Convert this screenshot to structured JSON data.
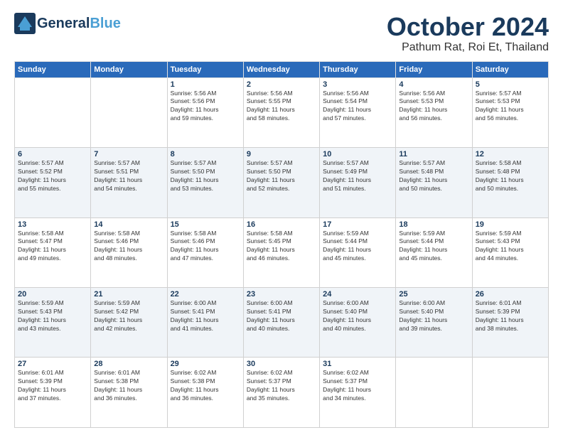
{
  "header": {
    "logo_main": "General",
    "logo_accent": "Blue",
    "month_title": "October 2024",
    "location": "Pathum Rat, Roi Et, Thailand"
  },
  "days_of_week": [
    "Sunday",
    "Monday",
    "Tuesday",
    "Wednesday",
    "Thursday",
    "Friday",
    "Saturday"
  ],
  "weeks": [
    [
      {
        "num": "",
        "info": ""
      },
      {
        "num": "",
        "info": ""
      },
      {
        "num": "1",
        "info": "Sunrise: 5:56 AM\nSunset: 5:56 PM\nDaylight: 11 hours\nand 59 minutes."
      },
      {
        "num": "2",
        "info": "Sunrise: 5:56 AM\nSunset: 5:55 PM\nDaylight: 11 hours\nand 58 minutes."
      },
      {
        "num": "3",
        "info": "Sunrise: 5:56 AM\nSunset: 5:54 PM\nDaylight: 11 hours\nand 57 minutes."
      },
      {
        "num": "4",
        "info": "Sunrise: 5:56 AM\nSunset: 5:53 PM\nDaylight: 11 hours\nand 56 minutes."
      },
      {
        "num": "5",
        "info": "Sunrise: 5:57 AM\nSunset: 5:53 PM\nDaylight: 11 hours\nand 56 minutes."
      }
    ],
    [
      {
        "num": "6",
        "info": "Sunrise: 5:57 AM\nSunset: 5:52 PM\nDaylight: 11 hours\nand 55 minutes."
      },
      {
        "num": "7",
        "info": "Sunrise: 5:57 AM\nSunset: 5:51 PM\nDaylight: 11 hours\nand 54 minutes."
      },
      {
        "num": "8",
        "info": "Sunrise: 5:57 AM\nSunset: 5:50 PM\nDaylight: 11 hours\nand 53 minutes."
      },
      {
        "num": "9",
        "info": "Sunrise: 5:57 AM\nSunset: 5:50 PM\nDaylight: 11 hours\nand 52 minutes."
      },
      {
        "num": "10",
        "info": "Sunrise: 5:57 AM\nSunset: 5:49 PM\nDaylight: 11 hours\nand 51 minutes."
      },
      {
        "num": "11",
        "info": "Sunrise: 5:57 AM\nSunset: 5:48 PM\nDaylight: 11 hours\nand 50 minutes."
      },
      {
        "num": "12",
        "info": "Sunrise: 5:58 AM\nSunset: 5:48 PM\nDaylight: 11 hours\nand 50 minutes."
      }
    ],
    [
      {
        "num": "13",
        "info": "Sunrise: 5:58 AM\nSunset: 5:47 PM\nDaylight: 11 hours\nand 49 minutes."
      },
      {
        "num": "14",
        "info": "Sunrise: 5:58 AM\nSunset: 5:46 PM\nDaylight: 11 hours\nand 48 minutes."
      },
      {
        "num": "15",
        "info": "Sunrise: 5:58 AM\nSunset: 5:46 PM\nDaylight: 11 hours\nand 47 minutes."
      },
      {
        "num": "16",
        "info": "Sunrise: 5:58 AM\nSunset: 5:45 PM\nDaylight: 11 hours\nand 46 minutes."
      },
      {
        "num": "17",
        "info": "Sunrise: 5:59 AM\nSunset: 5:44 PM\nDaylight: 11 hours\nand 45 minutes."
      },
      {
        "num": "18",
        "info": "Sunrise: 5:59 AM\nSunset: 5:44 PM\nDaylight: 11 hours\nand 45 minutes."
      },
      {
        "num": "19",
        "info": "Sunrise: 5:59 AM\nSunset: 5:43 PM\nDaylight: 11 hours\nand 44 minutes."
      }
    ],
    [
      {
        "num": "20",
        "info": "Sunrise: 5:59 AM\nSunset: 5:43 PM\nDaylight: 11 hours\nand 43 minutes."
      },
      {
        "num": "21",
        "info": "Sunrise: 5:59 AM\nSunset: 5:42 PM\nDaylight: 11 hours\nand 42 minutes."
      },
      {
        "num": "22",
        "info": "Sunrise: 6:00 AM\nSunset: 5:41 PM\nDaylight: 11 hours\nand 41 minutes."
      },
      {
        "num": "23",
        "info": "Sunrise: 6:00 AM\nSunset: 5:41 PM\nDaylight: 11 hours\nand 40 minutes."
      },
      {
        "num": "24",
        "info": "Sunrise: 6:00 AM\nSunset: 5:40 PM\nDaylight: 11 hours\nand 40 minutes."
      },
      {
        "num": "25",
        "info": "Sunrise: 6:00 AM\nSunset: 5:40 PM\nDaylight: 11 hours\nand 39 minutes."
      },
      {
        "num": "26",
        "info": "Sunrise: 6:01 AM\nSunset: 5:39 PM\nDaylight: 11 hours\nand 38 minutes."
      }
    ],
    [
      {
        "num": "27",
        "info": "Sunrise: 6:01 AM\nSunset: 5:39 PM\nDaylight: 11 hours\nand 37 minutes."
      },
      {
        "num": "28",
        "info": "Sunrise: 6:01 AM\nSunset: 5:38 PM\nDaylight: 11 hours\nand 36 minutes."
      },
      {
        "num": "29",
        "info": "Sunrise: 6:02 AM\nSunset: 5:38 PM\nDaylight: 11 hours\nand 36 minutes."
      },
      {
        "num": "30",
        "info": "Sunrise: 6:02 AM\nSunset: 5:37 PM\nDaylight: 11 hours\nand 35 minutes."
      },
      {
        "num": "31",
        "info": "Sunrise: 6:02 AM\nSunset: 5:37 PM\nDaylight: 11 hours\nand 34 minutes."
      },
      {
        "num": "",
        "info": ""
      },
      {
        "num": "",
        "info": ""
      }
    ]
  ]
}
